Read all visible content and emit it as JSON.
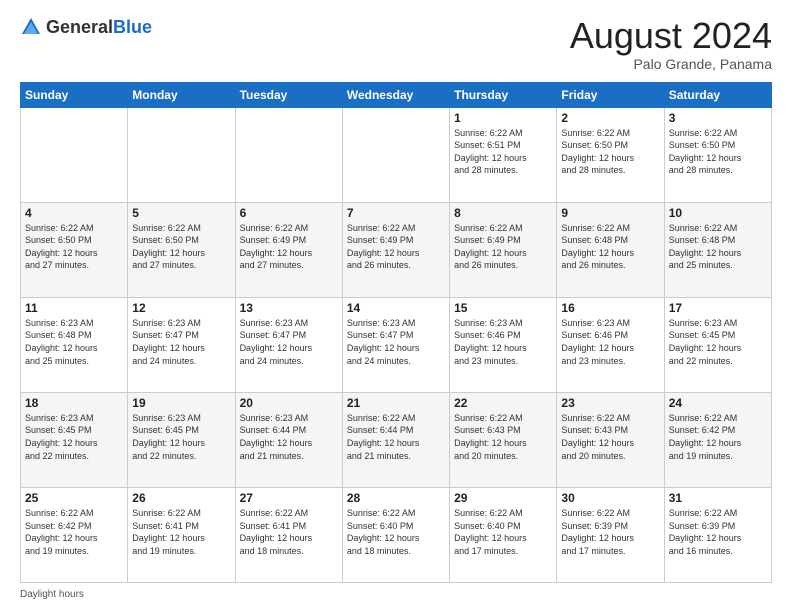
{
  "header": {
    "logo_general": "General",
    "logo_blue": "Blue",
    "month_year": "August 2024",
    "location": "Palo Grande, Panama"
  },
  "days_of_week": [
    "Sunday",
    "Monday",
    "Tuesday",
    "Wednesday",
    "Thursday",
    "Friday",
    "Saturday"
  ],
  "weeks": [
    [
      {
        "day": "",
        "info": ""
      },
      {
        "day": "",
        "info": ""
      },
      {
        "day": "",
        "info": ""
      },
      {
        "day": "",
        "info": ""
      },
      {
        "day": "1",
        "info": "Sunrise: 6:22 AM\nSunset: 6:51 PM\nDaylight: 12 hours\nand 28 minutes."
      },
      {
        "day": "2",
        "info": "Sunrise: 6:22 AM\nSunset: 6:50 PM\nDaylight: 12 hours\nand 28 minutes."
      },
      {
        "day": "3",
        "info": "Sunrise: 6:22 AM\nSunset: 6:50 PM\nDaylight: 12 hours\nand 28 minutes."
      }
    ],
    [
      {
        "day": "4",
        "info": "Sunrise: 6:22 AM\nSunset: 6:50 PM\nDaylight: 12 hours\nand 27 minutes."
      },
      {
        "day": "5",
        "info": "Sunrise: 6:22 AM\nSunset: 6:50 PM\nDaylight: 12 hours\nand 27 minutes."
      },
      {
        "day": "6",
        "info": "Sunrise: 6:22 AM\nSunset: 6:49 PM\nDaylight: 12 hours\nand 27 minutes."
      },
      {
        "day": "7",
        "info": "Sunrise: 6:22 AM\nSunset: 6:49 PM\nDaylight: 12 hours\nand 26 minutes."
      },
      {
        "day": "8",
        "info": "Sunrise: 6:22 AM\nSunset: 6:49 PM\nDaylight: 12 hours\nand 26 minutes."
      },
      {
        "day": "9",
        "info": "Sunrise: 6:22 AM\nSunset: 6:48 PM\nDaylight: 12 hours\nand 26 minutes."
      },
      {
        "day": "10",
        "info": "Sunrise: 6:22 AM\nSunset: 6:48 PM\nDaylight: 12 hours\nand 25 minutes."
      }
    ],
    [
      {
        "day": "11",
        "info": "Sunrise: 6:23 AM\nSunset: 6:48 PM\nDaylight: 12 hours\nand 25 minutes."
      },
      {
        "day": "12",
        "info": "Sunrise: 6:23 AM\nSunset: 6:47 PM\nDaylight: 12 hours\nand 24 minutes."
      },
      {
        "day": "13",
        "info": "Sunrise: 6:23 AM\nSunset: 6:47 PM\nDaylight: 12 hours\nand 24 minutes."
      },
      {
        "day": "14",
        "info": "Sunrise: 6:23 AM\nSunset: 6:47 PM\nDaylight: 12 hours\nand 24 minutes."
      },
      {
        "day": "15",
        "info": "Sunrise: 6:23 AM\nSunset: 6:46 PM\nDaylight: 12 hours\nand 23 minutes."
      },
      {
        "day": "16",
        "info": "Sunrise: 6:23 AM\nSunset: 6:46 PM\nDaylight: 12 hours\nand 23 minutes."
      },
      {
        "day": "17",
        "info": "Sunrise: 6:23 AM\nSunset: 6:45 PM\nDaylight: 12 hours\nand 22 minutes."
      }
    ],
    [
      {
        "day": "18",
        "info": "Sunrise: 6:23 AM\nSunset: 6:45 PM\nDaylight: 12 hours\nand 22 minutes."
      },
      {
        "day": "19",
        "info": "Sunrise: 6:23 AM\nSunset: 6:45 PM\nDaylight: 12 hours\nand 22 minutes."
      },
      {
        "day": "20",
        "info": "Sunrise: 6:23 AM\nSunset: 6:44 PM\nDaylight: 12 hours\nand 21 minutes."
      },
      {
        "day": "21",
        "info": "Sunrise: 6:22 AM\nSunset: 6:44 PM\nDaylight: 12 hours\nand 21 minutes."
      },
      {
        "day": "22",
        "info": "Sunrise: 6:22 AM\nSunset: 6:43 PM\nDaylight: 12 hours\nand 20 minutes."
      },
      {
        "day": "23",
        "info": "Sunrise: 6:22 AM\nSunset: 6:43 PM\nDaylight: 12 hours\nand 20 minutes."
      },
      {
        "day": "24",
        "info": "Sunrise: 6:22 AM\nSunset: 6:42 PM\nDaylight: 12 hours\nand 19 minutes."
      }
    ],
    [
      {
        "day": "25",
        "info": "Sunrise: 6:22 AM\nSunset: 6:42 PM\nDaylight: 12 hours\nand 19 minutes."
      },
      {
        "day": "26",
        "info": "Sunrise: 6:22 AM\nSunset: 6:41 PM\nDaylight: 12 hours\nand 19 minutes."
      },
      {
        "day": "27",
        "info": "Sunrise: 6:22 AM\nSunset: 6:41 PM\nDaylight: 12 hours\nand 18 minutes."
      },
      {
        "day": "28",
        "info": "Sunrise: 6:22 AM\nSunset: 6:40 PM\nDaylight: 12 hours\nand 18 minutes."
      },
      {
        "day": "29",
        "info": "Sunrise: 6:22 AM\nSunset: 6:40 PM\nDaylight: 12 hours\nand 17 minutes."
      },
      {
        "day": "30",
        "info": "Sunrise: 6:22 AM\nSunset: 6:39 PM\nDaylight: 12 hours\nand 17 minutes."
      },
      {
        "day": "31",
        "info": "Sunrise: 6:22 AM\nSunset: 6:39 PM\nDaylight: 12 hours\nand 16 minutes."
      }
    ]
  ],
  "footer": {
    "daylight_label": "Daylight hours"
  }
}
